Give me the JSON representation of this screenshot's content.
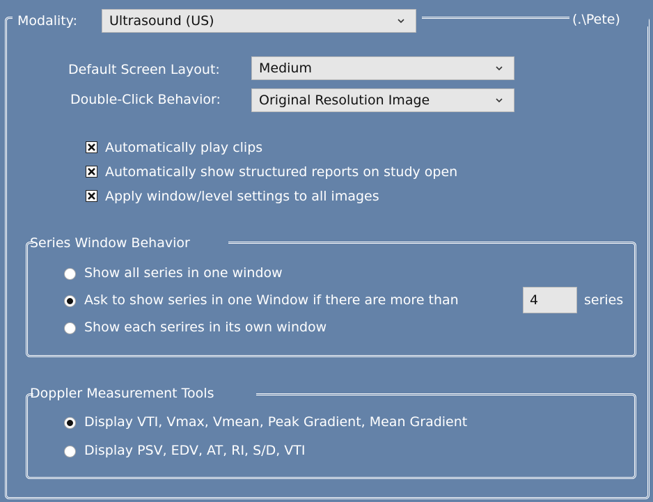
{
  "modality": {
    "label": "Modality:",
    "selected": "Ultrasound (US)",
    "owner": "(.\\Pete)"
  },
  "layout": {
    "label": "Default Screen Layout:",
    "selected": "Medium"
  },
  "double_click": {
    "label": "Double-Click Behavior:",
    "selected": "Original Resolution Image"
  },
  "options": [
    {
      "label": "Automatically play clips",
      "checked": true
    },
    {
      "label": "Automatically show structured reports on study open",
      "checked": true
    },
    {
      "label": "Apply window/level settings to all images",
      "checked": true
    }
  ],
  "series_window": {
    "title": "Series Window Behavior",
    "options": [
      {
        "label": "Show all series in one window",
        "selected": false
      },
      {
        "label": "Ask to show series in one Window if there are more than",
        "selected": true
      },
      {
        "label": "Show each serires in its own window",
        "selected": false
      }
    ],
    "threshold": "4",
    "threshold_suffix": "series"
  },
  "doppler": {
    "title": "Doppler Measurement Tools",
    "options": [
      {
        "label": "Display VTI, Vmax, Vmean, Peak Gradient, Mean Gradient",
        "selected": true
      },
      {
        "label": "Display PSV, EDV, AT, RI, S/D, VTI",
        "selected": false
      }
    ]
  }
}
